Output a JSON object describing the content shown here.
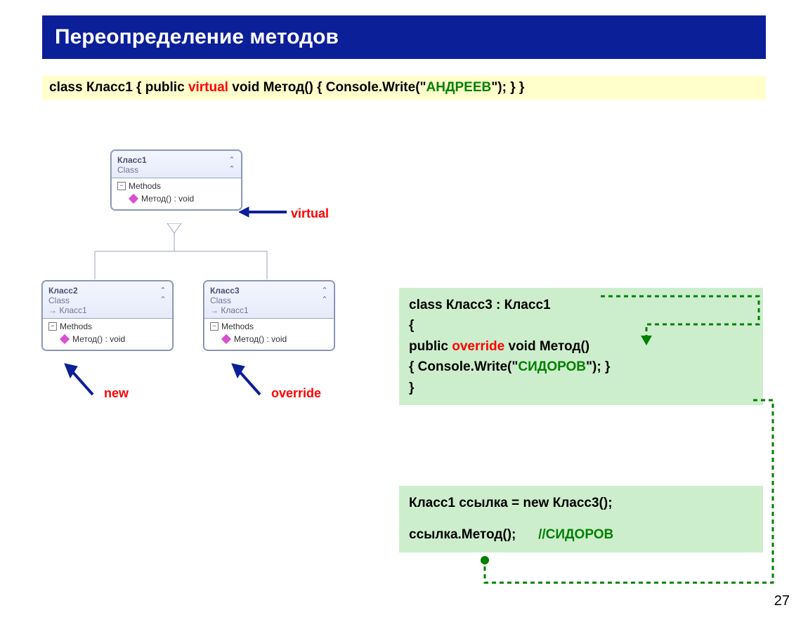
{
  "title": "Переопределение методов",
  "codebar": {
    "p1": "class Класс1  {   public ",
    "kw": "virtual",
    "p2": " void Метод() { Console.Write(\"",
    "literal": "АНДРЕЕВ",
    "p3": "\"); }   }"
  },
  "uml": {
    "c1": {
      "name": "Класс1",
      "stereo": "Class",
      "section": "Methods",
      "method": "Метод() : void"
    },
    "c2": {
      "name": "Класс2",
      "stereo": "Class",
      "inherits": "Класс1",
      "section": "Methods",
      "method": "Метод() : void"
    },
    "c3": {
      "name": "Класс3",
      "stereo": "Class",
      "inherits": "Класс1",
      "section": "Methods",
      "method": "Метод() : void"
    }
  },
  "labels": {
    "virtual": "virtual",
    "new": "new",
    "override": "override"
  },
  "greenbox1": {
    "l1a": "class Класс3 : Класс1",
    "l2": "{",
    "l3a": "   public ",
    "l3kw": "override",
    "l3b": " void Метод()",
    "l4a": "       { Console.Write(\"",
    "l4lit": "СИДОРОВ",
    "l4b": "\"); }",
    "l5": "}"
  },
  "greenbox2": {
    "l1": "Класс1 ссылка = new Класс3();",
    "l2a": "ссылка.Метод();",
    "l2gap": "      ",
    "l2b": "//",
    "l2c": "СИДОРОВ"
  },
  "pagenum": "27"
}
